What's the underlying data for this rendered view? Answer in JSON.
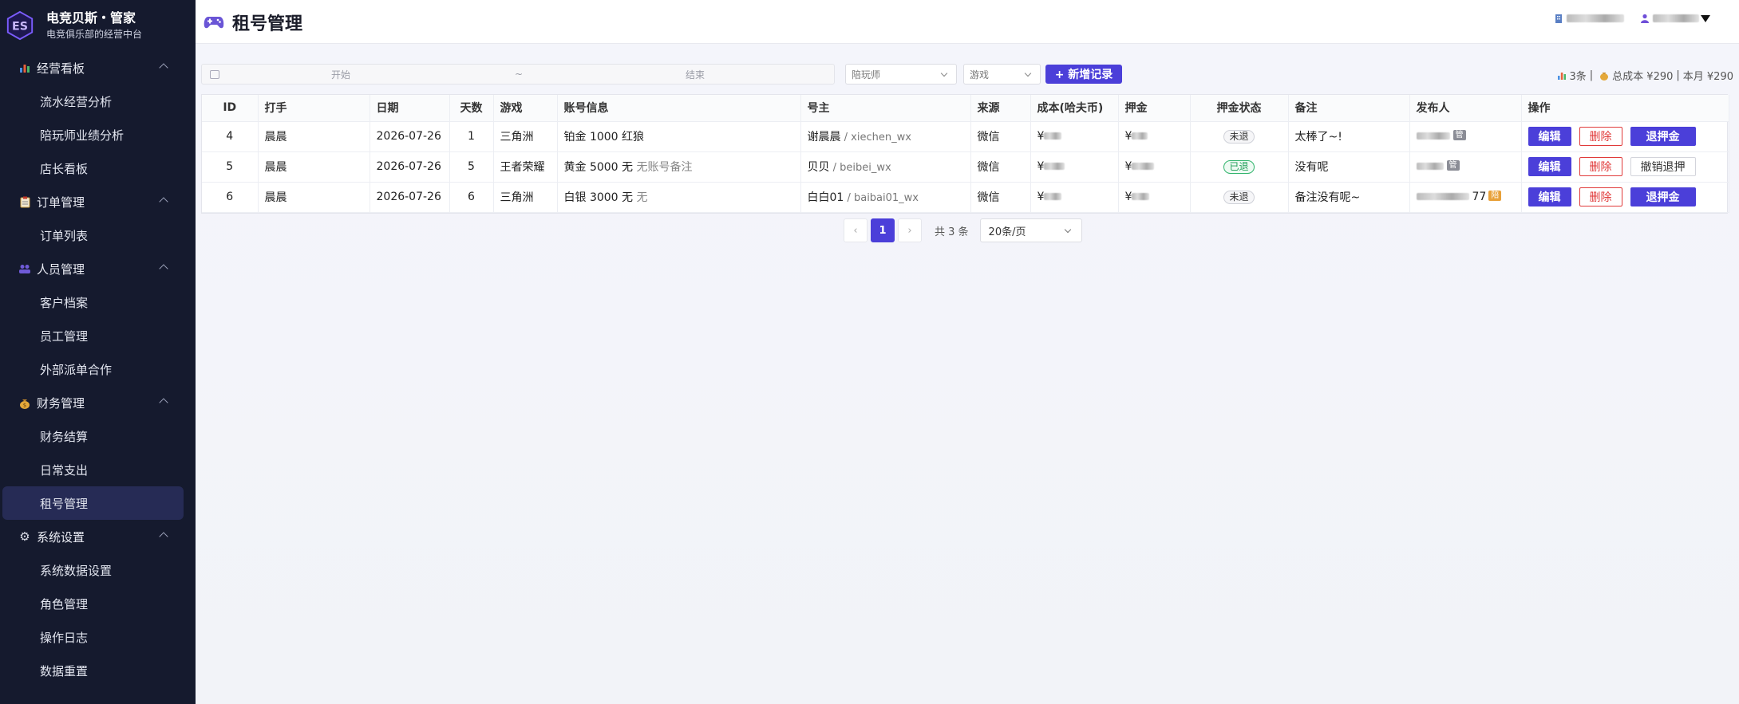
{
  "brand": {
    "title": "电竞贝斯・管家",
    "subtitle": "电竞俱乐部的经营中台",
    "logo_text": "ES"
  },
  "sidebar": {
    "groups": [
      {
        "label": "经营看板",
        "icon": "bar-chart-icon",
        "items": [
          "流水经营分析",
          "陪玩师业绩分析",
          "店长看板"
        ]
      },
      {
        "label": "订单管理",
        "icon": "clipboard-icon",
        "items": [
          "订单列表"
        ]
      },
      {
        "label": "人员管理",
        "icon": "people-icon",
        "items": [
          "客户档案",
          "员工管理",
          "外部派单合作"
        ]
      },
      {
        "label": "财务管理",
        "icon": "money-bag-icon",
        "items": [
          "财务结算",
          "日常支出",
          "租号管理"
        ]
      },
      {
        "label": "系统设置",
        "icon": "gear-icon",
        "items": [
          "系统数据设置",
          "角色管理",
          "操作日志",
          "数据重置"
        ]
      }
    ],
    "active_item": "租号管理"
  },
  "header": {
    "title": "租号管理"
  },
  "toolbar": {
    "date_start_placeholder": "开始",
    "date_sep": "~",
    "date_end_placeholder": "结束",
    "companion_select": "陪玩师",
    "game_select": "游戏",
    "add_button": "+ 新增记录",
    "stats": {
      "count": "3条",
      "sep": "|",
      "total_cost": "总成本 ¥290",
      "month_cost": "本月 ¥290"
    }
  },
  "table": {
    "columns": [
      "ID",
      "打手",
      "日期",
      "天数",
      "游戏",
      "账号信息",
      "号主",
      "来源",
      "成本(哈夫币)",
      "押金",
      "押金状态",
      "备注",
      "发布人",
      "操作"
    ],
    "rows": [
      {
        "id": "4",
        "player": "晨晨",
        "date": "2026-07-26",
        "days": "1",
        "game": "三角洲",
        "account_main": "铂金  1000  红狼",
        "account_note": "",
        "owner_name": "谢晨晨",
        "owner_wx": " / xiechen_wx",
        "source": "微信",
        "cost_prefix": "¥",
        "deposit_prefix": "¥",
        "deposit_status": "未退",
        "status_style": "grey",
        "remark": "太棒了~!",
        "publisher_badge": "管",
        "publisher_suffix": "",
        "actions": [
          "编辑",
          "删除",
          "退押金"
        ]
      },
      {
        "id": "5",
        "player": "晨晨",
        "date": "2026-07-26",
        "days": "5",
        "game": "王者荣耀",
        "account_main": "黄金  5000  无",
        "account_note": "  无账号备注",
        "owner_name": "贝贝",
        "owner_wx": " / beibei_wx",
        "source": "微信",
        "cost_prefix": "¥",
        "deposit_prefix": "¥",
        "deposit_status": "已退",
        "status_style": "green",
        "remark": "没有呢",
        "publisher_badge": "管",
        "publisher_suffix": "",
        "actions": [
          "编辑",
          "删除",
          "撤销退押"
        ]
      },
      {
        "id": "6",
        "player": "晨晨",
        "date": "2026-07-26",
        "days": "6",
        "game": "三角洲",
        "account_main": "白银  3000  无",
        "account_note": "  无",
        "owner_name": "白白01",
        "owner_wx": " / baibai01_wx",
        "source": "微信",
        "cost_prefix": "¥",
        "deposit_prefix": "¥",
        "deposit_status": "未退",
        "status_style": "grey",
        "remark": "备注没有呢~",
        "publisher_badge": "陪",
        "publisher_suffix": "77",
        "actions": [
          "编辑",
          "删除",
          "退押金"
        ]
      }
    ]
  },
  "pagination": {
    "prev": "‹",
    "current": "1",
    "next": "›",
    "total": "共 3 条",
    "page_size": "20条/页"
  },
  "colors": {
    "sidebar_bg": "#151a2e",
    "primary": "#4b3fd9",
    "danger": "#e03a3a",
    "success": "#1e9d56"
  }
}
